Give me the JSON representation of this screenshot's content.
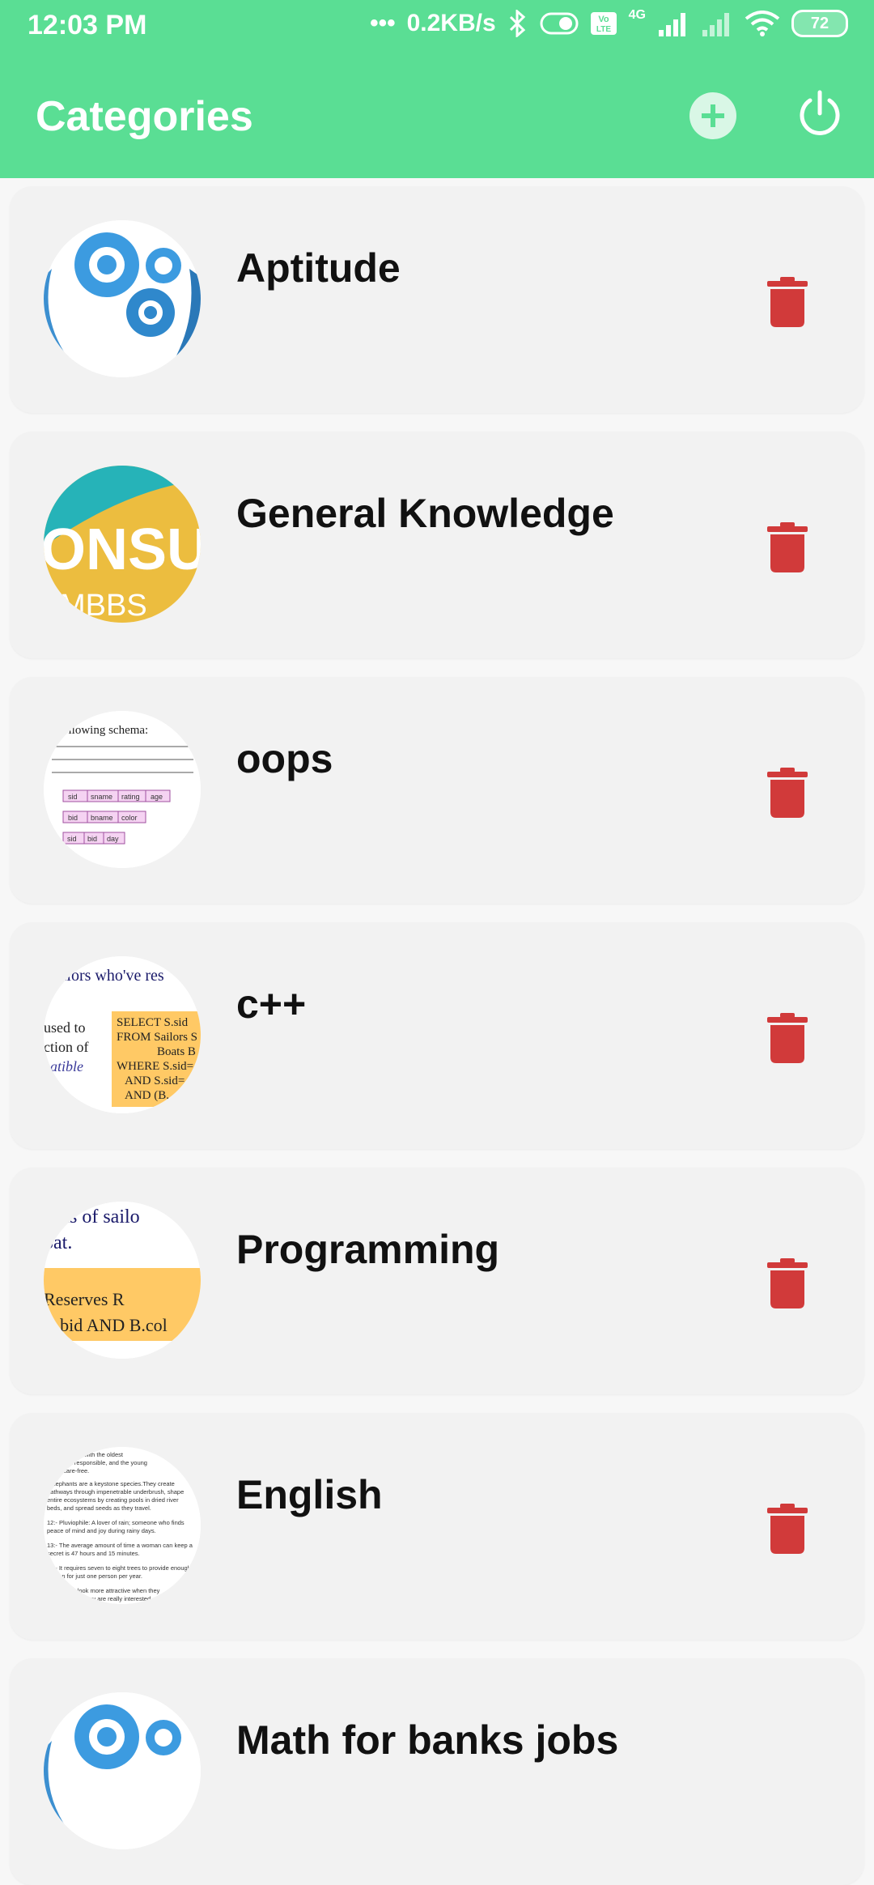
{
  "status": {
    "time": "12:03 PM",
    "speed": "0.2KB/s",
    "network": "4G",
    "battery": "72"
  },
  "appbar": {
    "title": "Categories"
  },
  "categories": [
    {
      "name": "Aptitude",
      "thumb": "gears-image"
    },
    {
      "name": "General Knowledge",
      "thumb": "consult-mbbs-image"
    },
    {
      "name": "oops",
      "thumb": "schema-image"
    },
    {
      "name": "c++",
      "thumb": "sql-query-image"
    },
    {
      "name": "Programming",
      "thumb": "sql-text-image"
    },
    {
      "name": "English",
      "thumb": "facts-text-image"
    },
    {
      "name": "Math for banks jobs",
      "thumb": "gears-image"
    }
  ],
  "thumb_text": {
    "gk_main": "ONSU",
    "gk_sub": "MBBS",
    "oops_line1": "following schema:",
    "oops_row1": [
      "sid",
      "sname",
      "rating",
      "age"
    ],
    "oops_row2": [
      "bid",
      "bname",
      "color"
    ],
    "oops_row3": [
      "sid",
      "bid",
      "day"
    ],
    "cpp_line1": "ailors who've res",
    "cpp_left": [
      "used to",
      "ction of",
      "eatible"
    ],
    "cpp_code": [
      "SELECT S.sid",
      "FROM Sailors S",
      "Boats B",
      "WHERE S.sid=",
      "AND S.sid=",
      "AND (B."
    ],
    "prog_line1": "sids of sailo",
    "prog_line2": "oat.",
    "prog_line3": "Reserves R",
    "prog_line4": "R.bid AND B.col",
    "eng_lines": [
      "with the oldest",
      "st responsible, and the young",
      "t care-free.",
      "Elephants are a keystone species.They create",
      "pathways through impenetrable underbrush, shape",
      "entire ecosystems by creating pools in dried river",
      "beds, and spread seeds as they travel.",
      "12:- Pluviophile: A lover of rain; someone who finds",
      "peace of mind and joy during rainy days.",
      "13:- The average amount of time a woman can keep a",
      "secret is 47 hours and 15 minutes.",
      "4:- It requires seven to eight trees to provide enough",
      "gen for just one person per year.",
      "He look more attractive when they",
      "they are really interested"
    ]
  },
  "colors": {
    "accent": "#5ade94",
    "delete": "#d13a3a",
    "card": "#f2f2f2"
  }
}
